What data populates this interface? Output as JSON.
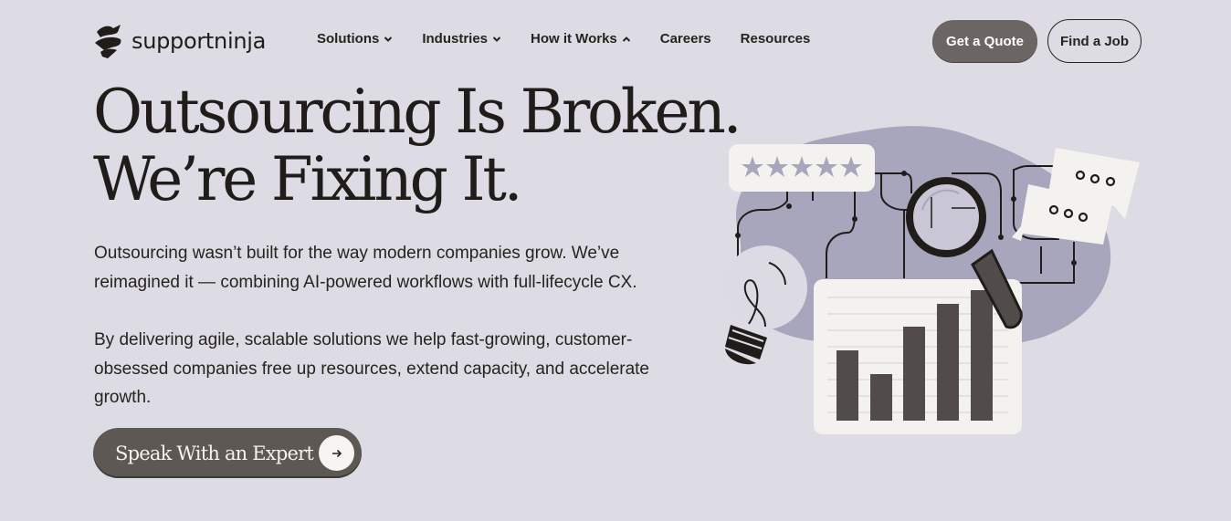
{
  "header": {
    "logo_text": "supportninja",
    "nav": [
      {
        "label": "Solutions",
        "chevron": "down"
      },
      {
        "label": "Industries",
        "chevron": "down"
      },
      {
        "label": "How it Works",
        "chevron": "up"
      },
      {
        "label": "Careers"
      },
      {
        "label": "Resources"
      }
    ],
    "get_quote_label": "Get a Quote",
    "find_job_label": "Find a Job"
  },
  "hero": {
    "title_line1": "Outsourcing Is Broken.",
    "title_line2": "We’re Fixing It.",
    "paragraph1": "Outsourcing wasn’t built for the way modern companies grow. We’ve reimagined it — combining AI-powered workflows with full-lifecycle CX.",
    "paragraph2": "By delivering agile, scalable solutions we help fast-growing, customer-obsessed companies free up resources, extend capacity, and accelerate growth.",
    "cta_label": "Speak With an Expert"
  },
  "illustration": {
    "rating_stars": 5,
    "bar_chart_values": [
      5,
      3,
      6,
      8,
      9.5
    ],
    "chat_bubble_dots": "ooo"
  },
  "colors": {
    "background": "#dddbe3",
    "primary_button": "#6b6664",
    "cta_button": "#5e5855",
    "text_dark": "#1f1c1a"
  }
}
